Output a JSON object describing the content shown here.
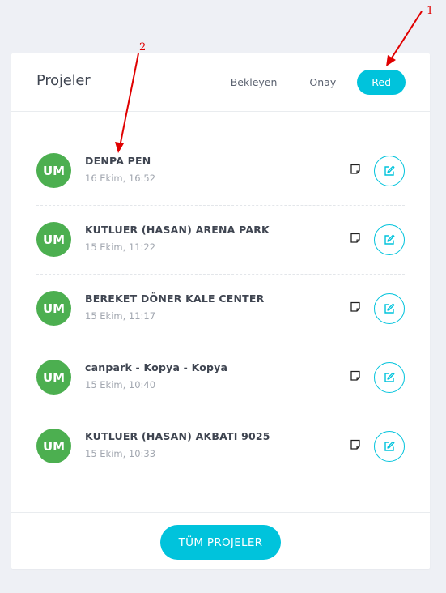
{
  "card": {
    "title": "Projeler",
    "tabs": [
      {
        "label": "Bekleyen",
        "active": false
      },
      {
        "label": "Onay",
        "active": false
      },
      {
        "label": "Red",
        "active": true
      }
    ]
  },
  "projects": [
    {
      "initials": "UM",
      "name": "DENPA PEN",
      "date": "16 Ekim, 16:52"
    },
    {
      "initials": "UM",
      "name": "KUTLUER (HASAN) ARENA PARK",
      "date": "15 Ekim, 11:22"
    },
    {
      "initials": "UM",
      "name": "BEREKET DÖNER KALE CENTER",
      "date": "15 Ekim, 11:17"
    },
    {
      "initials": "UM",
      "name": "canpark - Kopya - Kopya",
      "date": "15 Ekim, 10:40"
    },
    {
      "initials": "UM",
      "name": "KUTLUER (HASAN) AKBATI 9025",
      "date": "15 Ekim, 10:33"
    }
  ],
  "footer": {
    "all_projects_label": "TÜM PROJELER"
  },
  "annotations": {
    "marker_1": "1",
    "marker_2": "2"
  },
  "colors": {
    "accent": "#00c3dc",
    "avatar": "#4caf50",
    "annotation": "#e00000"
  },
  "icons": {
    "note": "note-icon",
    "edit": "edit-icon"
  }
}
